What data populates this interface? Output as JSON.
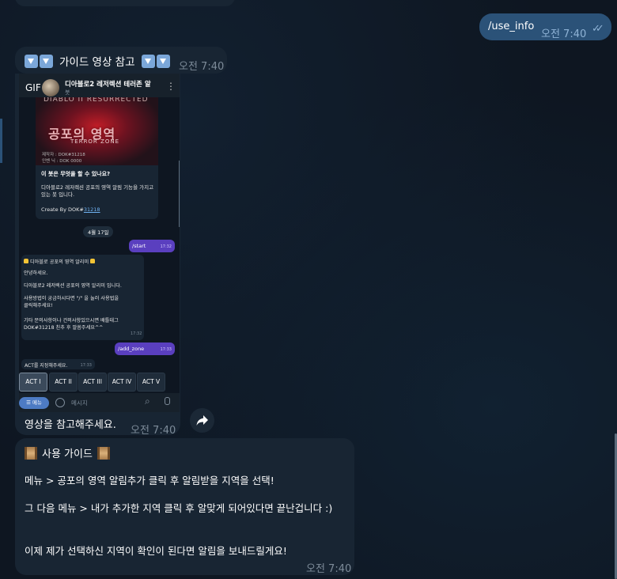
{
  "chat": {
    "out_command": {
      "text": "/use_info",
      "time": "오전 7:40"
    },
    "video_header": {
      "text": "가이드 영상 참고",
      "time": "오전 7:40",
      "icon": "down-arrow-emoji"
    },
    "gif": {
      "label": "GIF",
      "bot_name": "디아블로2 레저렉션 테러존 알",
      "bot_sub": "봇",
      "poster": {
        "top": "DIABLO II RESURRECTED",
        "title": "공포의 영역",
        "subtitle": "TERROR ZONE",
        "small1": "제작자 : DOK#31218",
        "small2": "인벤 닉 : DOK 0000"
      },
      "intro_question": "이 봇은 무엇을 할 수 있나요?",
      "intro_desc": "디아블로2 레저렉션 공포의 영역 알림 기능을 가지고 있는 봇 입니다.",
      "created_by": "Create By DOK#",
      "created_by_link": "31218",
      "date_chip": "4월 17일",
      "start_cmd": {
        "text": "/start",
        "time": "17:32"
      },
      "welcome": {
        "title": "디아블로 공포의 영역 알리미",
        "l1": "안녕하세요.",
        "l2": "디아블로2 레저렉션 공포의 영역 알리미 입니다.",
        "l3": "사용방법이 궁금하시다면 \"/\" 을 눌러 사용법을",
        "l4": "클릭해주세요!",
        "l5": "기타 문의사항이나 건의사항있으시면 배틀태그",
        "l6": "DOK#31218 친추 후 말씀주세요^^",
        "time": "17:32"
      },
      "addzone_cmd": {
        "text": "/add_zone",
        "time": "17:33"
      },
      "act_prompt": {
        "text": "ACT를 지정해주세요.",
        "time": "17:33"
      },
      "acts": [
        "ACT I",
        "ACT II",
        "ACT III",
        "ACT IV",
        "ACT V"
      ],
      "menu_label": "메뉴",
      "message_placeholder": "메시지",
      "caption": "영상을 참고해주세요.",
      "time": "오전 7:40"
    },
    "guide": {
      "title": "사용 가이드",
      "line1": "메뉴 > 공포의 영역 알림추가 클릭 후 알림받을 지역을 선택!",
      "line2": "그 다음 메뉴 > 내가 추가한 지역 클릭 후 알맞게 되어있다면 끝난겁니다 :)",
      "line3": "이제 제가 선택하신 지역이 확인이 된다면 알림을 보내드릴게요!",
      "time": "오전 7:40"
    }
  },
  "colors": {
    "background": "#0e1621",
    "incoming_bubble": "#182533",
    "outgoing_bubble": "#2b5278",
    "accent_purple": "#5a3fbf"
  }
}
